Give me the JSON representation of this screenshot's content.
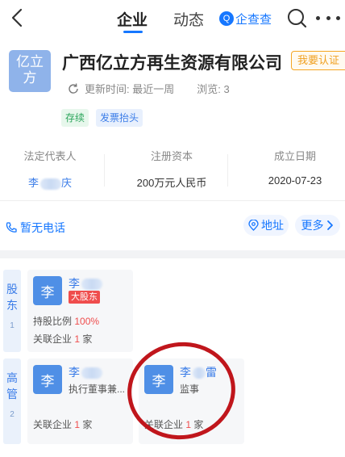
{
  "nav": {
    "tabs": [
      "企业",
      "动态"
    ],
    "brand_label": "企查查",
    "brand_logo": "Q",
    "accent": "#1677ff"
  },
  "company": {
    "logo_line1": "亿立",
    "logo_line2": "方",
    "name": "广西亿立方再生资源有限公司",
    "verify_label": "我要认证",
    "update_text": "更新时间: 最近一周",
    "views_text": "浏览: 3",
    "tags": [
      "存续",
      "发票抬头"
    ],
    "legal_rep_label": "法定代表人",
    "legal_rep_value": "李",
    "legal_rep_suffix": "庆",
    "capital_label": "注册资本",
    "capital_value": "200万元人民币",
    "founded_label": "成立日期",
    "founded_value": "2020-07-23",
    "phone_label": "暂无电话",
    "address_label": "地址",
    "more_label": "更多"
  },
  "people": {
    "shareholder_section": {
      "line1": "股",
      "line2": "东",
      "count": "1"
    },
    "manager_section": {
      "line1": "高",
      "line2": "管",
      "count": "2"
    },
    "shareholders": [
      {
        "avatar": "李",
        "name": "李",
        "badge": "大股东",
        "ratio_label": "持股比例",
        "ratio_value": "100%",
        "rel_prefix": "关联企业",
        "rel_count": "1",
        "rel_suffix": "家"
      }
    ],
    "managers": [
      {
        "avatar": "李",
        "name": "李",
        "role": "执行董事兼...",
        "rel_prefix": "关联企业",
        "rel_count": "1",
        "rel_suffix": "家"
      },
      {
        "avatar": "李",
        "name": "李",
        "name_suffix": "雷",
        "role": "监事",
        "rel_prefix": "关联企业",
        "rel_count": "1",
        "rel_suffix": "家"
      }
    ]
  }
}
